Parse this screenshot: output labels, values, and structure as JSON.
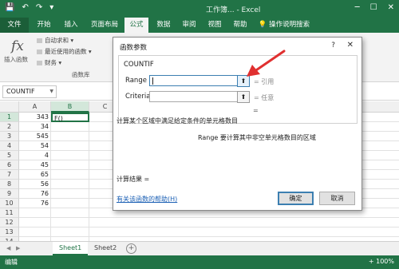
{
  "window": {
    "title": "工作簿... - Excel",
    "quick_access": [
      "💾",
      "↶",
      "↷",
      "▾"
    ],
    "controls": [
      "─",
      "☐",
      "✕"
    ]
  },
  "tabs": [
    {
      "label": "文件",
      "type": "file"
    },
    {
      "label": "开始"
    },
    {
      "label": "插入"
    },
    {
      "label": "页面布局"
    },
    {
      "label": "公式",
      "active": true
    },
    {
      "label": "数据"
    },
    {
      "label": "审阅"
    },
    {
      "label": "视图"
    },
    {
      "label": "帮助"
    },
    {
      "label": "操作说明搜索",
      "type": "search"
    }
  ],
  "ribbon": {
    "insert_function": "插入函数",
    "items": [
      "自动求和 ▾",
      "最近使用的函数 ▾",
      "财务 ▾"
    ],
    "group_label": "函数库"
  },
  "namebox": {
    "value": "COUNTIF"
  },
  "grid": {
    "columns": [
      "A",
      "B",
      "C"
    ],
    "rows": [
      "1",
      "2",
      "3",
      "4",
      "5",
      "6",
      "7",
      "8",
      "9",
      "10",
      "11",
      "12",
      "13",
      "14"
    ],
    "colA": [
      "343",
      "34",
      "545",
      "54",
      "4",
      "45",
      "65",
      "56",
      "76",
      "76",
      "",
      "",
      "",
      ""
    ],
    "b1": "F()"
  },
  "sheets": {
    "tabs": [
      "Sheet1",
      "Sheet2"
    ],
    "add": "+"
  },
  "status": {
    "mode": "编辑",
    "zoom": "+ 100%"
  },
  "dialog": {
    "title": "函数参数",
    "help": "?",
    "close": "✕",
    "function_name": "COUNTIF",
    "args": [
      {
        "label": "Range",
        "result": "= 引用"
      },
      {
        "label": "Criteria",
        "result": "= 任意"
      }
    ],
    "collapse_icon": "⬆",
    "equals": "=",
    "description": "计算某个区域中满足给定条件的单元格数目",
    "arg_description": "Range  要计算其中非空单元格数目的区域",
    "calc_result": "计算结果 =",
    "help_link": "有关该函数的帮助(H)",
    "ok": "确定",
    "cancel": "取消"
  },
  "colors": {
    "excel_green": "#217346",
    "annotation_red": "#e03030"
  }
}
